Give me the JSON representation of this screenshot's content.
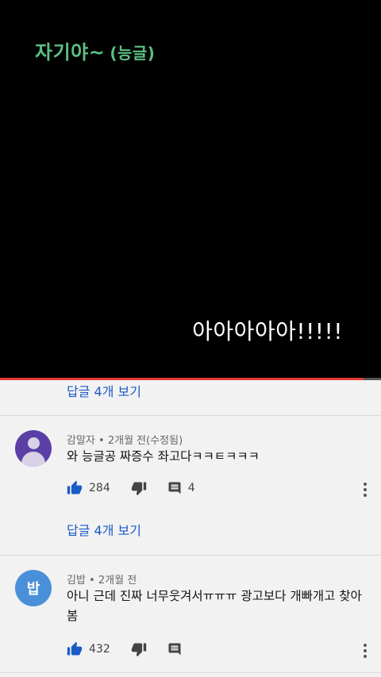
{
  "video": {
    "caption_top": "자기야~",
    "caption_top_small": "(능글)",
    "caption_bottom": "아아아아아!!!!!",
    "progress": 0.955
  },
  "reply_links": {
    "first": "답글 4개 보기",
    "second": "답글 4개 보기"
  },
  "comments": [
    {
      "author": "감말자",
      "time": "2개월 전(수정됨)",
      "text": "와 능글공 짜증수 좌고다ㅋㅋㅌㅋㅋㅋ",
      "likes": "284",
      "replies": "4",
      "avatar": "default-person-avatar"
    },
    {
      "author": "김밥",
      "time": "2개월 전",
      "text": "아니 근데 진짜 너무웃겨서ㅠㅠㅠ 광고보다 개빠개고 찾아봄",
      "likes": "432",
      "replies": "",
      "avatar_letter": "밥"
    }
  ],
  "colors": {
    "link": "#1a5bc7",
    "caption_green": "#5cbf84",
    "progress_red": "#e53935"
  }
}
